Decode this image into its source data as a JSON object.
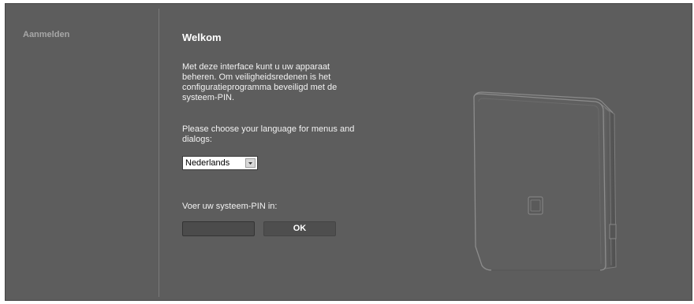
{
  "sidebar": {
    "items": [
      {
        "label": "Aanmelden"
      }
    ]
  },
  "main": {
    "title": "Welkom",
    "intro": "Met deze interface kunt u uw apparaat beheren. Om veiligheidsredenen is het configuratieprogramma beveiligd met de systeem-PIN.",
    "language_prompt": "Please choose your language for menus and dialogs:",
    "language_select": {
      "selected": "Nederlands"
    },
    "pin_prompt": "Voer uw systeem-PIN in:",
    "pin_input": {
      "value": "",
      "placeholder": ""
    },
    "ok_label": "OK"
  },
  "device_image": {
    "icon": "base-station-device"
  },
  "colors": {
    "background": "#5d5d5d",
    "page": "#ffffff",
    "text": "#f2f2f2",
    "sidebar_text": "#a7a7a7"
  }
}
